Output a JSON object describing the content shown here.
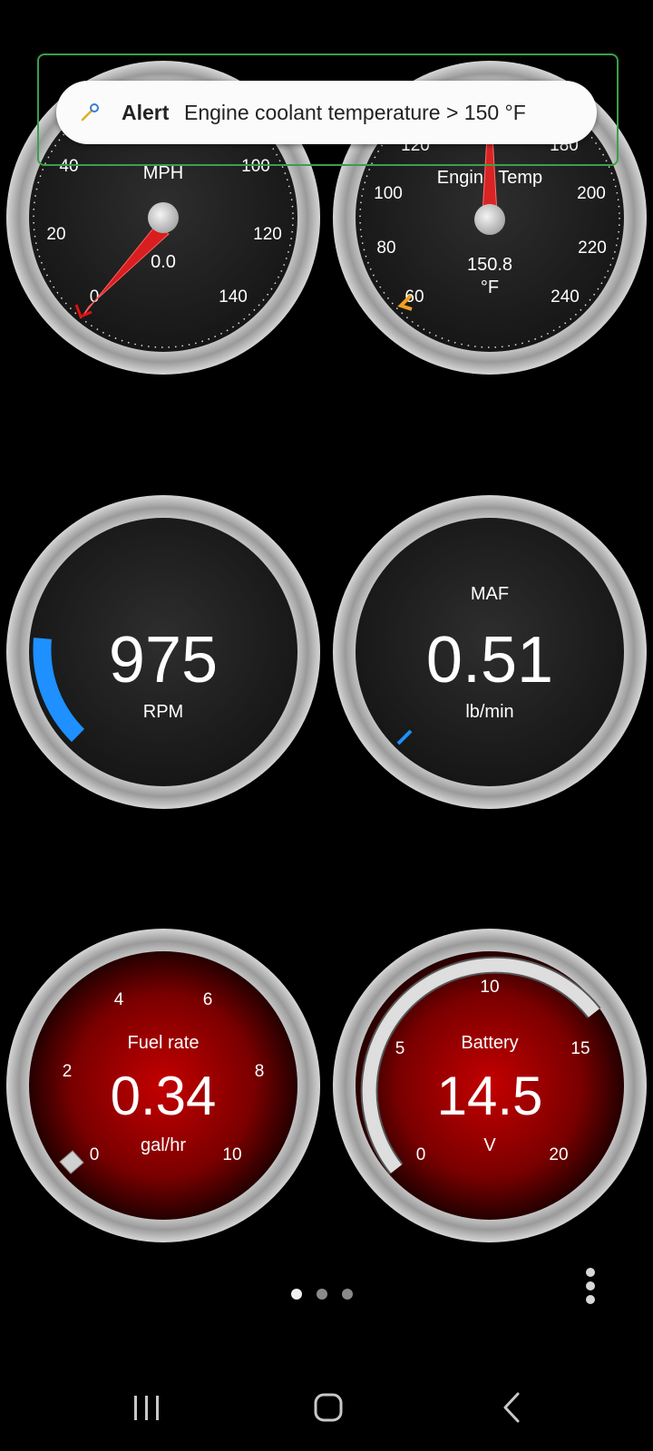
{
  "alert": {
    "title": "Alert",
    "message": "Engine coolant temperature > 150 °F",
    "icon": "wrench-icon"
  },
  "gauges": {
    "speed": {
      "label": "MPH",
      "value": "0.0",
      "ticks": [
        "0",
        "20",
        "40",
        "100",
        "120",
        "140"
      ],
      "needle_value": 0,
      "needle_color": "#e02020"
    },
    "engine_temp": {
      "label": "Engine Temp",
      "value": "150.8",
      "unit": "°F",
      "ticks": [
        "60",
        "80",
        "100",
        "120",
        "180",
        "200",
        "220",
        "240"
      ],
      "needle_value": 150.8,
      "needle_color": "#e03030",
      "alert_marker_color": "#f0a020"
    },
    "rpm": {
      "label": "RPM",
      "value": "975",
      "bar_color": "#1e90ff"
    },
    "maf": {
      "label": "MAF",
      "value": "0.51",
      "unit": "lb/min",
      "bar_color": "#1e90ff"
    },
    "fuel_rate": {
      "label": "Fuel rate",
      "value": "0.34",
      "unit": "gal/hr",
      "ticks": [
        "0",
        "2",
        "4",
        "6",
        "8",
        "10"
      ],
      "level": 0.034
    },
    "battery": {
      "label": "Battery",
      "value": "14.5",
      "unit": "V",
      "ticks": [
        "0",
        "5",
        "10",
        "15",
        "20"
      ],
      "level": 0.725
    }
  },
  "pager": {
    "pages": 3,
    "active": 0
  },
  "colors": {
    "bezel": "#b8b8b8",
    "dark_face": "#1c1c1c",
    "red_face": "#c00000",
    "accent_blue": "#1e90ff"
  }
}
